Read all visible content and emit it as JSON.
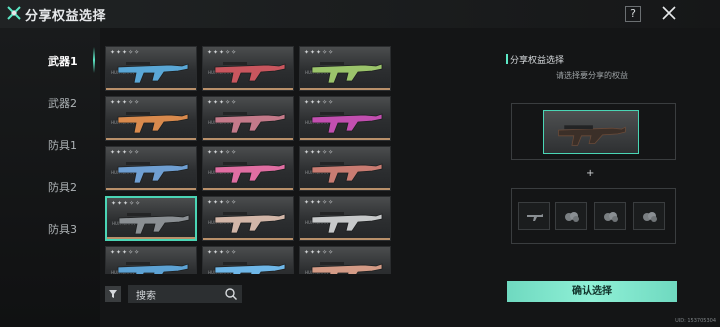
{
  "header": {
    "title": "分享权益选择",
    "help_label": "?"
  },
  "tabs": [
    {
      "label": "武器1",
      "active": true
    },
    {
      "label": "武器2",
      "active": false
    },
    {
      "label": "防具1",
      "active": false
    },
    {
      "label": "防具2",
      "active": false
    },
    {
      "label": "防具3",
      "active": false
    }
  ],
  "grid": {
    "brand": "HUNTSMAN",
    "stars": "✦✦✦✧✧",
    "items": [
      {
        "accent": "#5aa7d6",
        "bar": "#b9906a"
      },
      {
        "accent": "#c9565e",
        "bar": "#b9906a"
      },
      {
        "accent": "#9bc46b",
        "bar": "#b9906a"
      },
      {
        "accent": "#d98a4d",
        "bar": "#b9906a"
      },
      {
        "accent": "#c47a8a",
        "bar": "#b9906a"
      },
      {
        "accent": "#c24fb0",
        "bar": "#b9906a"
      },
      {
        "accent": "#6f9fd2",
        "bar": "#b9906a"
      },
      {
        "accent": "#e06ea2",
        "bar": "#b9906a"
      },
      {
        "accent": "#c97c72",
        "bar": "#b9906a"
      },
      {
        "accent": "#8a8f93",
        "bar": "#b9906a",
        "selected": true
      },
      {
        "accent": "#d2b6a8",
        "bar": "#b9906a"
      },
      {
        "accent": "#c7c9ca",
        "bar": "#b9906a"
      },
      {
        "accent": "#5da2d4",
        "bar": "#b9906a"
      },
      {
        "accent": "#6fb7e8",
        "bar": "#b9906a"
      },
      {
        "accent": "#d49b86",
        "bar": "#b9906a"
      }
    ]
  },
  "search": {
    "label": "搜索"
  },
  "panel": {
    "title": "分享权益选择",
    "subtitle": "请选择要分享的权益",
    "plus": "+"
  },
  "confirm_label": "确认选择",
  "uid": "UID: 153705304",
  "colors": {
    "accent": "#5ce8c6",
    "selected_border": "#4ad5b5",
    "button": "#7fe3ca"
  }
}
